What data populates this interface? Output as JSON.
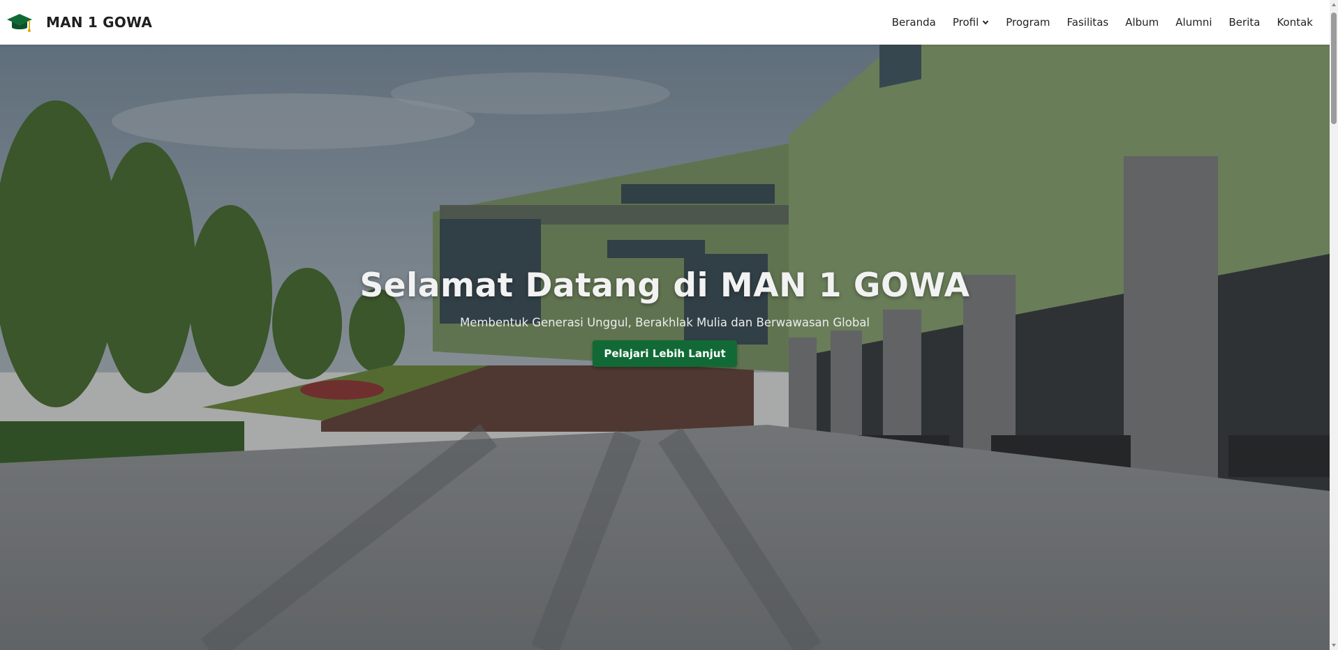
{
  "brand": {
    "name": "MAN 1 GOWA",
    "icon": "graduation-cap-icon",
    "color": "#116a35"
  },
  "nav": {
    "items": [
      {
        "label": "Beranda"
      },
      {
        "label": "Profil",
        "icon": "chevron-down-icon"
      },
      {
        "label": "Program"
      },
      {
        "label": "Fasilitas"
      },
      {
        "label": "Album"
      },
      {
        "label": "Alumni"
      },
      {
        "label": "Berita"
      },
      {
        "label": "Kontak"
      }
    ]
  },
  "hero": {
    "title": "Selamat Datang di MAN 1 GOWA",
    "subtitle": "Membentuk Generasi Unggul, Berakhlak Mulia dan Berwawasan Global",
    "button_label": "Pelajari Lebih Lanjut",
    "button_color": "#116a35"
  }
}
